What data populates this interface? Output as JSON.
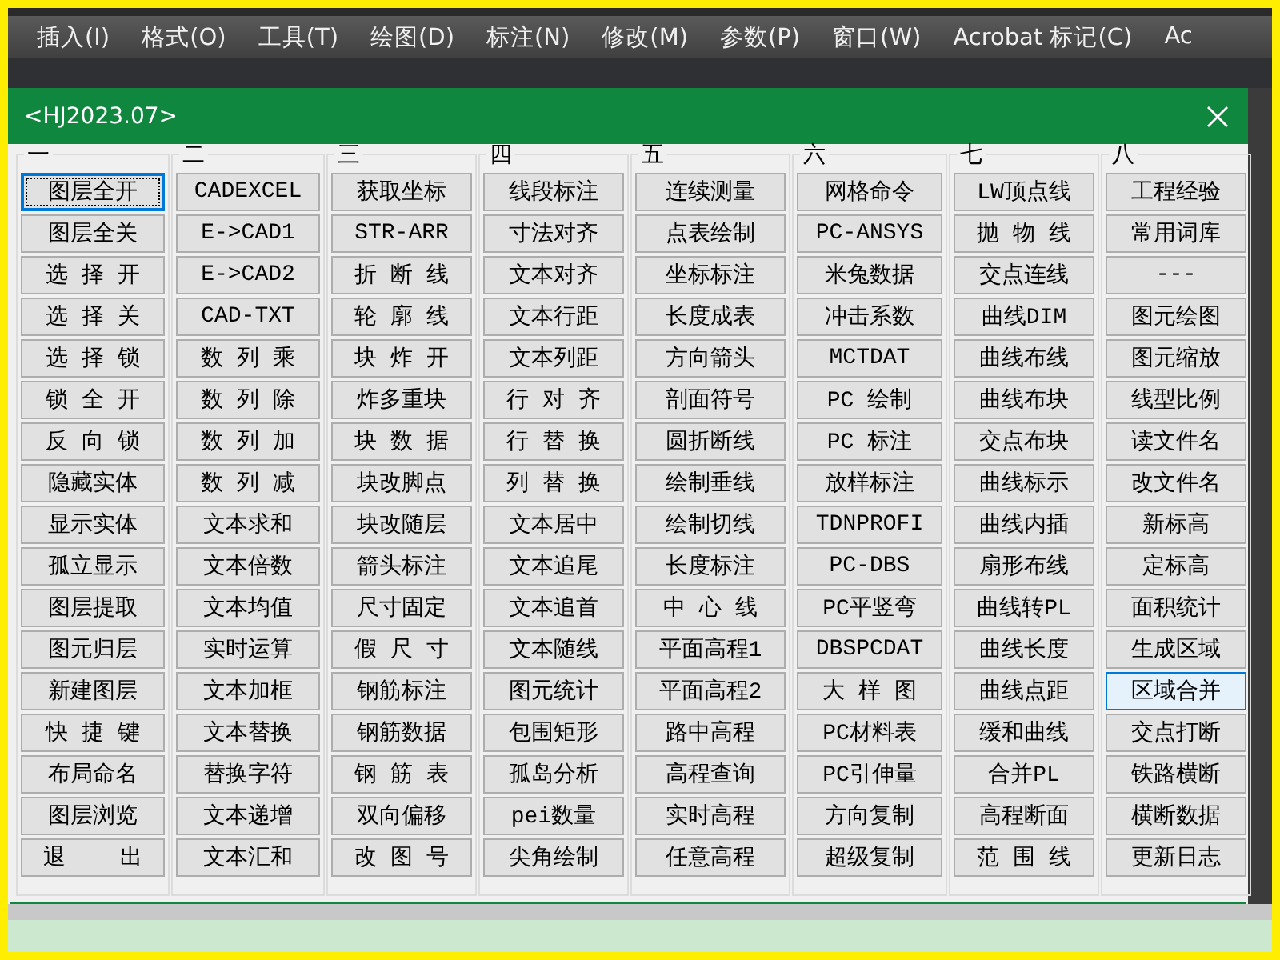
{
  "menu_bar": {
    "items": [
      "插入(I)",
      "格式(O)",
      "工具(T)",
      "绘图(D)",
      "标注(N)",
      "修改(M)",
      "参数(P)",
      "窗口(W)",
      "Acrobat 标记(C)",
      "Ac"
    ]
  },
  "dialog": {
    "title": "<HJ2023.07>",
    "groups": [
      {
        "header": "一",
        "buttons": [
          {
            "label": "图层全开",
            "focused": true,
            "hovered": false
          },
          {
            "label": "图层全关",
            "focused": false,
            "hovered": false
          },
          {
            "label": "选 择 开",
            "focused": false,
            "hovered": false
          },
          {
            "label": "选 择 关",
            "focused": false,
            "hovered": false
          },
          {
            "label": "选 择 锁",
            "focused": false,
            "hovered": false
          },
          {
            "label": "锁 全 开",
            "focused": false,
            "hovered": false
          },
          {
            "label": "反 向 锁",
            "focused": false,
            "hovered": false
          },
          {
            "label": "隐藏实体",
            "focused": false,
            "hovered": false
          },
          {
            "label": "显示实体",
            "focused": false,
            "hovered": false
          },
          {
            "label": "孤立显示",
            "focused": false,
            "hovered": false
          },
          {
            "label": "图层提取",
            "focused": false,
            "hovered": false
          },
          {
            "label": "图元归层",
            "focused": false,
            "hovered": false
          },
          {
            "label": "新建图层",
            "focused": false,
            "hovered": false
          },
          {
            "label": "快 捷 键",
            "focused": false,
            "hovered": false
          },
          {
            "label": "布局命名",
            "focused": false,
            "hovered": false
          },
          {
            "label": "图层浏览",
            "focused": false,
            "hovered": false
          },
          {
            "label": "退    出",
            "focused": false,
            "hovered": false
          }
        ]
      },
      {
        "header": "二",
        "buttons": [
          {
            "label": "CADEXCEL",
            "focused": false,
            "hovered": false
          },
          {
            "label": "E->CAD1",
            "focused": false,
            "hovered": false
          },
          {
            "label": "E->CAD2",
            "focused": false,
            "hovered": false
          },
          {
            "label": "CAD-TXT",
            "focused": false,
            "hovered": false
          },
          {
            "label": "数 列 乘",
            "focused": false,
            "hovered": false
          },
          {
            "label": "数 列 除",
            "focused": false,
            "hovered": false
          },
          {
            "label": "数 列 加",
            "focused": false,
            "hovered": false
          },
          {
            "label": "数 列 减",
            "focused": false,
            "hovered": false
          },
          {
            "label": "文本求和",
            "focused": false,
            "hovered": false
          },
          {
            "label": "文本倍数",
            "focused": false,
            "hovered": false
          },
          {
            "label": "文本均值",
            "focused": false,
            "hovered": false
          },
          {
            "label": "实时运算",
            "focused": false,
            "hovered": false
          },
          {
            "label": "文本加框",
            "focused": false,
            "hovered": false
          },
          {
            "label": "文本替换",
            "focused": false,
            "hovered": false
          },
          {
            "label": "替换字符",
            "focused": false,
            "hovered": false
          },
          {
            "label": "文本递增",
            "focused": false,
            "hovered": false
          },
          {
            "label": "文本汇和",
            "focused": false,
            "hovered": false
          }
        ]
      },
      {
        "header": "三",
        "buttons": [
          {
            "label": "获取坐标",
            "focused": false,
            "hovered": false
          },
          {
            "label": "STR-ARR",
            "focused": false,
            "hovered": false
          },
          {
            "label": "折 断 线",
            "focused": false,
            "hovered": false
          },
          {
            "label": "轮 廓 线",
            "focused": false,
            "hovered": false
          },
          {
            "label": "块 炸 开",
            "focused": false,
            "hovered": false
          },
          {
            "label": "炸多重块",
            "focused": false,
            "hovered": false
          },
          {
            "label": "块 数 据",
            "focused": false,
            "hovered": false
          },
          {
            "label": "块改脚点",
            "focused": false,
            "hovered": false
          },
          {
            "label": "块改随层",
            "focused": false,
            "hovered": false
          },
          {
            "label": "箭头标注",
            "focused": false,
            "hovered": false
          },
          {
            "label": "尺寸固定",
            "focused": false,
            "hovered": false
          },
          {
            "label": "假 尺 寸",
            "focused": false,
            "hovered": false
          },
          {
            "label": "钢筋标注",
            "focused": false,
            "hovered": false
          },
          {
            "label": "钢筋数据",
            "focused": false,
            "hovered": false
          },
          {
            "label": "钢 筋 表",
            "focused": false,
            "hovered": false
          },
          {
            "label": "双向偏移",
            "focused": false,
            "hovered": false
          },
          {
            "label": "改 图 号",
            "focused": false,
            "hovered": false
          }
        ]
      },
      {
        "header": "四",
        "buttons": [
          {
            "label": "线段标注",
            "focused": false,
            "hovered": false
          },
          {
            "label": "寸法对齐",
            "focused": false,
            "hovered": false
          },
          {
            "label": "文本对齐",
            "focused": false,
            "hovered": false
          },
          {
            "label": "文本行距",
            "focused": false,
            "hovered": false
          },
          {
            "label": "文本列距",
            "focused": false,
            "hovered": false
          },
          {
            "label": "行 对 齐",
            "focused": false,
            "hovered": false
          },
          {
            "label": "行 替 换",
            "focused": false,
            "hovered": false
          },
          {
            "label": "列 替 换",
            "focused": false,
            "hovered": false
          },
          {
            "label": "文本居中",
            "focused": false,
            "hovered": false
          },
          {
            "label": "文本追尾",
            "focused": false,
            "hovered": false
          },
          {
            "label": "文本追首",
            "focused": false,
            "hovered": false
          },
          {
            "label": "文本随线",
            "focused": false,
            "hovered": false
          },
          {
            "label": "图元统计",
            "focused": false,
            "hovered": false
          },
          {
            "label": "包围矩形",
            "focused": false,
            "hovered": false
          },
          {
            "label": "孤岛分析",
            "focused": false,
            "hovered": false
          },
          {
            "label": "pei数量",
            "focused": false,
            "hovered": false
          },
          {
            "label": "尖角绘制",
            "focused": false,
            "hovered": false
          }
        ]
      },
      {
        "header": "五",
        "buttons": [
          {
            "label": "连续测量",
            "focused": false,
            "hovered": false
          },
          {
            "label": "点表绘制",
            "focused": false,
            "hovered": false
          },
          {
            "label": "坐标标注",
            "focused": false,
            "hovered": false
          },
          {
            "label": "长度成表",
            "focused": false,
            "hovered": false
          },
          {
            "label": "方向箭头",
            "focused": false,
            "hovered": false
          },
          {
            "label": "剖面符号",
            "focused": false,
            "hovered": false
          },
          {
            "label": "圆折断线",
            "focused": false,
            "hovered": false
          },
          {
            "label": "绘制垂线",
            "focused": false,
            "hovered": false
          },
          {
            "label": "绘制切线",
            "focused": false,
            "hovered": false
          },
          {
            "label": "长度标注",
            "focused": false,
            "hovered": false
          },
          {
            "label": "中 心 线",
            "focused": false,
            "hovered": false
          },
          {
            "label": "平面高程1",
            "focused": false,
            "hovered": false
          },
          {
            "label": "平面高程2",
            "focused": false,
            "hovered": false
          },
          {
            "label": "路中高程",
            "focused": false,
            "hovered": false
          },
          {
            "label": "高程查询",
            "focused": false,
            "hovered": false
          },
          {
            "label": "实时高程",
            "focused": false,
            "hovered": false
          },
          {
            "label": "任意高程",
            "focused": false,
            "hovered": false
          }
        ]
      },
      {
        "header": "六",
        "buttons": [
          {
            "label": "网格命令",
            "focused": false,
            "hovered": false
          },
          {
            "label": "PC-ANSYS",
            "focused": false,
            "hovered": false
          },
          {
            "label": "米兔数据",
            "focused": false,
            "hovered": false
          },
          {
            "label": "冲击系数",
            "focused": false,
            "hovered": false
          },
          {
            "label": "MCTDAT",
            "focused": false,
            "hovered": false
          },
          {
            "label": "PC 绘制",
            "focused": false,
            "hovered": false
          },
          {
            "label": "PC 标注",
            "focused": false,
            "hovered": false
          },
          {
            "label": "放样标注",
            "focused": false,
            "hovered": false
          },
          {
            "label": "TDNPROFI",
            "focused": false,
            "hovered": false
          },
          {
            "label": "PC-DBS",
            "focused": false,
            "hovered": false
          },
          {
            "label": "PC平竖弯",
            "focused": false,
            "hovered": false
          },
          {
            "label": "DBSPCDAT",
            "focused": false,
            "hovered": false
          },
          {
            "label": "大 样 图",
            "focused": false,
            "hovered": false
          },
          {
            "label": "PC材料表",
            "focused": false,
            "hovered": false
          },
          {
            "label": "PC引伸量",
            "focused": false,
            "hovered": false
          },
          {
            "label": "方向复制",
            "focused": false,
            "hovered": false
          },
          {
            "label": "超级复制",
            "focused": false,
            "hovered": false
          }
        ]
      },
      {
        "header": "七",
        "buttons": [
          {
            "label": "LW顶点线",
            "focused": false,
            "hovered": false
          },
          {
            "label": "抛 物 线",
            "focused": false,
            "hovered": false
          },
          {
            "label": "交点连线",
            "focused": false,
            "hovered": false
          },
          {
            "label": "曲线DIM",
            "focused": false,
            "hovered": false
          },
          {
            "label": "曲线布线",
            "focused": false,
            "hovered": false
          },
          {
            "label": "曲线布块",
            "focused": false,
            "hovered": false
          },
          {
            "label": "交点布块",
            "focused": false,
            "hovered": false
          },
          {
            "label": "曲线标示",
            "focused": false,
            "hovered": false
          },
          {
            "label": "曲线内插",
            "focused": false,
            "hovered": false
          },
          {
            "label": "扇形布线",
            "focused": false,
            "hovered": false
          },
          {
            "label": "曲线转PL",
            "focused": false,
            "hovered": false
          },
          {
            "label": "曲线长度",
            "focused": false,
            "hovered": false
          },
          {
            "label": "曲线点距",
            "focused": false,
            "hovered": false
          },
          {
            "label": "缓和曲线",
            "focused": false,
            "hovered": false
          },
          {
            "label": "合并PL",
            "focused": false,
            "hovered": false
          },
          {
            "label": "高程断面",
            "focused": false,
            "hovered": false
          },
          {
            "label": "范 围 线",
            "focused": false,
            "hovered": false
          }
        ]
      },
      {
        "header": "八",
        "buttons": [
          {
            "label": "工程经验",
            "focused": false,
            "hovered": false
          },
          {
            "label": "常用词库",
            "focused": false,
            "hovered": false
          },
          {
            "label": "---",
            "focused": false,
            "hovered": false
          },
          {
            "label": "图元绘图",
            "focused": false,
            "hovered": false
          },
          {
            "label": "图元缩放",
            "focused": false,
            "hovered": false
          },
          {
            "label": "线型比例",
            "focused": false,
            "hovered": false
          },
          {
            "label": "读文件名",
            "focused": false,
            "hovered": false
          },
          {
            "label": "改文件名",
            "focused": false,
            "hovered": false
          },
          {
            "label": "新标高",
            "focused": false,
            "hovered": false
          },
          {
            "label": "定标高",
            "focused": false,
            "hovered": false
          },
          {
            "label": "面积统计",
            "focused": false,
            "hovered": false
          },
          {
            "label": "生成区域",
            "focused": false,
            "hovered": false
          },
          {
            "label": "区域合并",
            "focused": false,
            "hovered": true
          },
          {
            "label": "交点打断",
            "focused": false,
            "hovered": false
          },
          {
            "label": "铁路横断",
            "focused": false,
            "hovered": false
          },
          {
            "label": "横断数据",
            "focused": false,
            "hovered": false
          },
          {
            "label": "更新日志",
            "focused": false,
            "hovered": false
          }
        ]
      }
    ]
  }
}
